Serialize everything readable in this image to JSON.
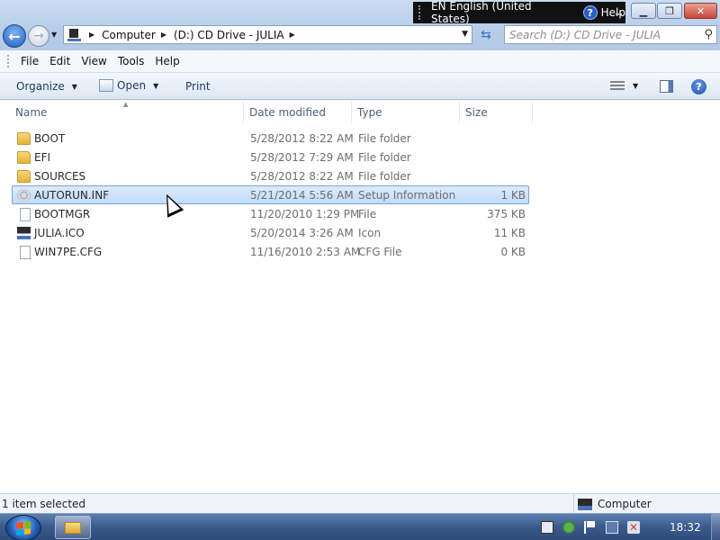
{
  "langbar": {
    "label": "EN English (United States)",
    "help": "Help"
  },
  "address": {
    "crumbs": [
      "Computer",
      "(D:) CD Drive - JULIA"
    ]
  },
  "search": {
    "placeholder": "Search (D:) CD Drive - JULIA"
  },
  "menu": [
    "File",
    "Edit",
    "View",
    "Tools",
    "Help"
  ],
  "commands": {
    "organize": "Organize",
    "open": "Open",
    "print": "Print"
  },
  "columns": {
    "name": "Name",
    "date": "Date modified",
    "type": "Type",
    "size": "Size"
  },
  "files": [
    {
      "name": "BOOT",
      "date": "5/28/2012 8:22 AM",
      "type": "File folder",
      "size": "",
      "icon": "folder-icon"
    },
    {
      "name": "EFI",
      "date": "5/28/2012 7:29 AM",
      "type": "File folder",
      "size": "",
      "icon": "folder-icon"
    },
    {
      "name": "SOURCES",
      "date": "5/28/2012 8:22 AM",
      "type": "File folder",
      "size": "",
      "icon": "folder-icon"
    },
    {
      "name": "AUTORUN.INF",
      "date": "5/21/2014 5:56 AM",
      "type": "Setup Information",
      "size": "1 KB",
      "icon": "setup-file-icon",
      "selected": true
    },
    {
      "name": "BOOTMGR",
      "date": "11/20/2010 1:29 PM",
      "type": "File",
      "size": "375 KB",
      "icon": "file-icon"
    },
    {
      "name": "JULIA.ICO",
      "date": "5/20/2014 3:26 AM",
      "type": "Icon",
      "size": "11 KB",
      "icon": "ico-file-icon"
    },
    {
      "name": "WIN7PE.CFG",
      "date": "11/16/2010 2:53 AM",
      "type": "CFG File",
      "size": "0 KB",
      "icon": "file-icon"
    }
  ],
  "status": {
    "left": "1 item selected",
    "right": "Computer"
  },
  "taskbar": {
    "clock": "18:32"
  },
  "colors": {
    "selection": "#c1dbfc",
    "taskbar": "#3a5a8c",
    "folder": "#e6b33b"
  }
}
